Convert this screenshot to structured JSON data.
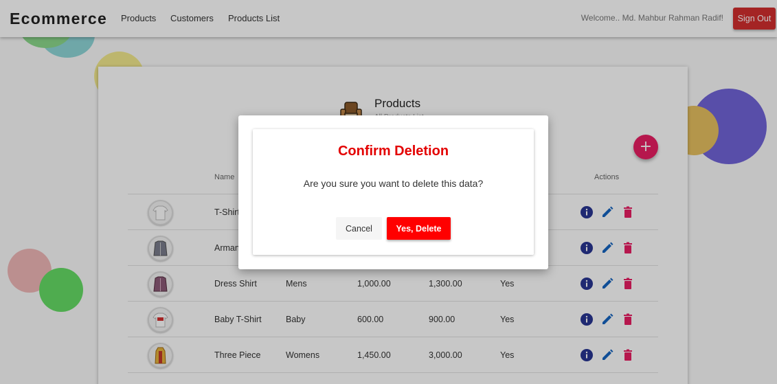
{
  "app": {
    "brand": "Ecommerce",
    "nav": [
      "Products",
      "Customers",
      "Products List"
    ],
    "welcome": "Welcome.. Md. Mahbur Rahman Radif!",
    "sign_out": "Sign Out"
  },
  "card": {
    "icon": "sofa-icon",
    "title": "Products",
    "subtitle": "All Products List"
  },
  "table": {
    "headers": [
      "Name",
      "Actions"
    ],
    "rows": [
      {
        "name": "T-Shirt",
        "category": "",
        "buy": "",
        "sell": "",
        "available": "",
        "thumb": "white-tshirt"
      },
      {
        "name": "Arman",
        "category": "",
        "buy": "",
        "sell": "",
        "available": "",
        "thumb": "grey-shirt"
      },
      {
        "name": "Dress Shirt",
        "category": "Mens",
        "buy": "1,000.00",
        "sell": "1,300.00",
        "available": "Yes",
        "thumb": "purple-shirt"
      },
      {
        "name": "Baby T-Shirt",
        "category": "Baby",
        "buy": "600.00",
        "sell": "900.00",
        "available": "Yes",
        "thumb": "baby-tshirt"
      },
      {
        "name": "Three Piece",
        "category": "Womens",
        "buy": "1,450.00",
        "sell": "3,000.00",
        "available": "Yes",
        "thumb": "three-piece"
      }
    ],
    "action_icons": [
      "info-icon",
      "edit-icon",
      "delete-icon"
    ]
  },
  "dialog": {
    "title": "Confirm Deletion",
    "message": "Are you sure you want to delete this data?",
    "cancel": "Cancel",
    "confirm": "Yes, Delete"
  },
  "colors": {
    "signout": "#d32f2f",
    "fab": "#e91e63",
    "info": "#283593",
    "edit": "#1565c0",
    "delete": "#e91e63",
    "dialog_title": "#e30000",
    "dialog_confirm": "#ff0000"
  }
}
